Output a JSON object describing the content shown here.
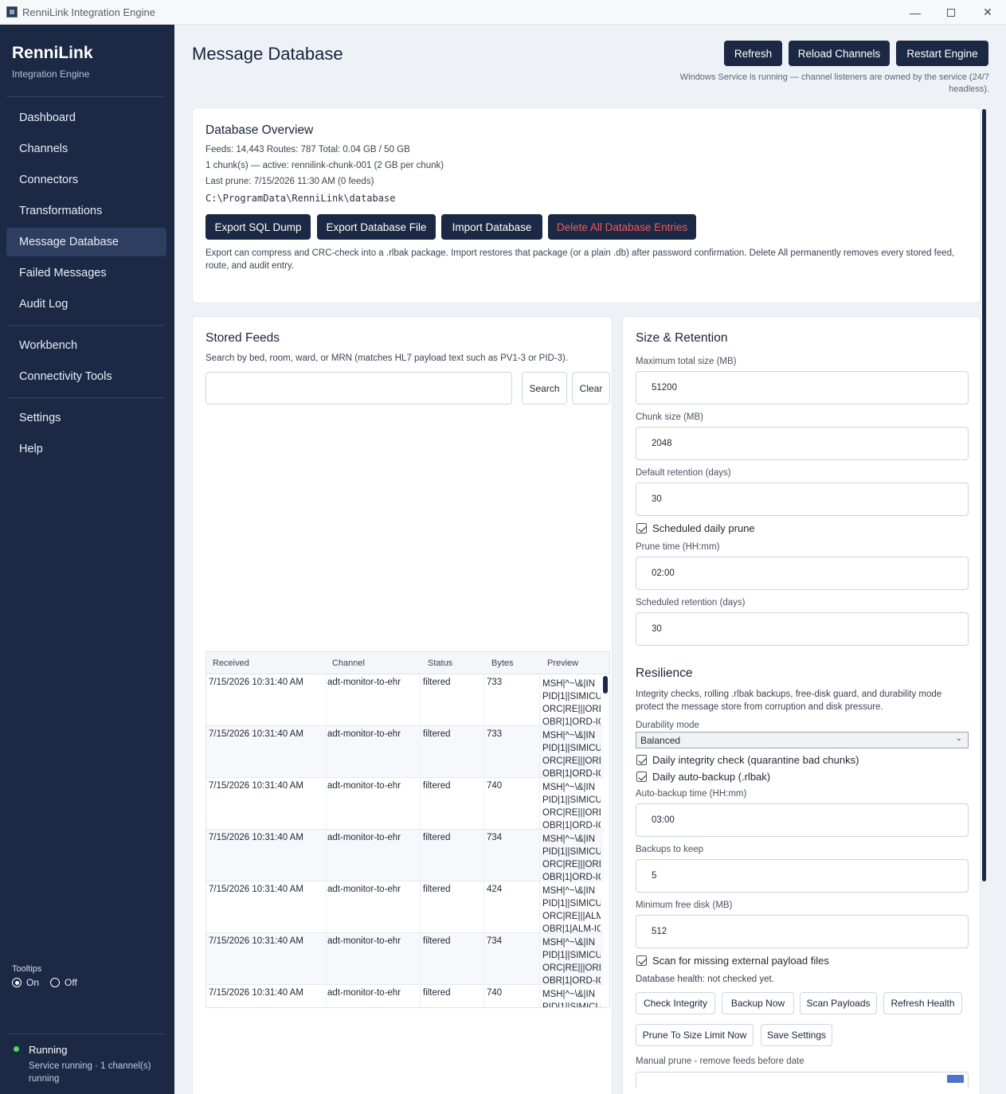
{
  "window": {
    "title": "RenniLink Integration Engine"
  },
  "sidebar": {
    "brand": "RenniLink",
    "subtitle": "Integration Engine",
    "items": [
      {
        "label": "Dashboard"
      },
      {
        "label": "Channels"
      },
      {
        "label": "Connectors"
      },
      {
        "label": "Transformations"
      },
      {
        "label": "Message Database",
        "active": true
      },
      {
        "label": "Failed Messages"
      },
      {
        "label": "Audit Log"
      },
      {
        "label": "Workbench"
      },
      {
        "label": "Connectivity Tools"
      },
      {
        "label": "Settings"
      },
      {
        "label": "Help"
      }
    ],
    "tooltips": {
      "label": "Tooltips",
      "on": "On",
      "off": "Off",
      "selected": "On"
    },
    "status": {
      "title": "Running",
      "detail": "Service running · 1 channel(s) running",
      "color": "#4cd964"
    }
  },
  "header": {
    "title": "Message Database",
    "buttons": {
      "refresh": "Refresh",
      "reload": "Reload Channels",
      "restart": "Restart Engine"
    },
    "service_note": "Windows Service is running — channel listeners are owned by the service (24/7 headless)."
  },
  "overview": {
    "title": "Database Overview",
    "stats": "Feeds: 14,443  Routes: 787  Total: 0.04 GB / 50 GB",
    "chunks": "1 chunk(s) — active: rennilink-chunk-001 (2 GB per chunk)",
    "last_prune": "Last prune: 7/15/2026 11:30 AM (0 feeds)",
    "path": "C:\\ProgramData\\RenniLink\\database",
    "buttons": {
      "export_sql": "Export SQL Dump",
      "export_file": "Export Database File",
      "import": "Import Database",
      "delete_all": "Delete All Database Entries"
    },
    "note": "Export can compress and CRC-check into a .rlbak package. Import restores that package (or a plain .db) after password confirmation. Delete All permanently removes every stored feed, route, and audit entry."
  },
  "feeds": {
    "title": "Stored Feeds",
    "hint": "Search by bed, room, ward, or MRN (matches HL7 payload text such as PV1-3 or PID-3).",
    "search_value": "",
    "search_label": "Search",
    "clear_label": "Clear",
    "columns": {
      "received": "Received",
      "channel": "Channel",
      "status": "Status",
      "bytes": "Bytes",
      "preview": "Preview"
    },
    "rows": [
      {
        "received": "7/15/2026 10:31:40 AM",
        "channel": "adt-monitor-to-ehr",
        "status": "filtered",
        "bytes": "733",
        "p1": "MSH|^~\\&|IN",
        "p2": "PID|1||SIMICU",
        "p3": "ORC|RE|||ORD",
        "p4": "OBR|1|ORD-IC"
      },
      {
        "received": "7/15/2026 10:31:40 AM",
        "channel": "adt-monitor-to-ehr",
        "status": "filtered",
        "bytes": "733",
        "p1": "MSH|^~\\&|IN",
        "p2": "PID|1||SIMICU",
        "p3": "ORC|RE|||ORD",
        "p4": "OBR|1|ORD-IC"
      },
      {
        "received": "7/15/2026 10:31:40 AM",
        "channel": "adt-monitor-to-ehr",
        "status": "filtered",
        "bytes": "740",
        "p1": "MSH|^~\\&|IN",
        "p2": "PID|1||SIMICU",
        "p3": "ORC|RE|||ORD",
        "p4": "OBR|1|ORD-IC"
      },
      {
        "received": "7/15/2026 10:31:40 AM",
        "channel": "adt-monitor-to-ehr",
        "status": "filtered",
        "bytes": "734",
        "p1": "MSH|^~\\&|IN",
        "p2": "PID|1||SIMICU",
        "p3": "ORC|RE|||ORD",
        "p4": "OBR|1|ORD-IC"
      },
      {
        "received": "7/15/2026 10:31:40 AM",
        "channel": "adt-monitor-to-ehr",
        "status": "filtered",
        "bytes": "424",
        "p1": "MSH|^~\\&|IN",
        "p2": "PID|1||SIMICU",
        "p3": "ORC|RE|||ALM",
        "p4": "OBR|1|ALM-IC"
      },
      {
        "received": "7/15/2026 10:31:40 AM",
        "channel": "adt-monitor-to-ehr",
        "status": "filtered",
        "bytes": "734",
        "p1": "MSH|^~\\&|IN",
        "p2": "PID|1||SIMICU",
        "p3": "ORC|RE|||ORD",
        "p4": "OBR|1|ORD-IC"
      },
      {
        "received": "7/15/2026 10:31:40 AM",
        "channel": "adt-monitor-to-ehr",
        "status": "filtered",
        "bytes": "740",
        "p1": "MSH|^~\\&|IN",
        "p2": "PID|1||SIMICU",
        "p3": "",
        "p4": ""
      }
    ]
  },
  "retention": {
    "title": "Size & Retention",
    "max_size_label": "Maximum total size (MB)",
    "max_size": "51200",
    "chunk_label": "Chunk size (MB)",
    "chunk": "2048",
    "default_ret_label": "Default retention (days)",
    "default_ret": "30",
    "daily_prune_label": "Scheduled daily prune",
    "prune_time_label": "Prune time (HH:mm)",
    "prune_time": "02:00",
    "sched_ret_label": "Scheduled retention (days)",
    "sched_ret": "30"
  },
  "resilience": {
    "title": "Resilience",
    "desc": "Integrity checks, rolling .rlbak backups, free-disk guard, and durability mode protect the message store from corruption and disk pressure.",
    "durability_label": "Durability mode",
    "durability": "Balanced",
    "integrity_label": "Daily integrity check (quarantine bad chunks)",
    "autobackup_label": "Daily auto-backup (.rlbak)",
    "backup_time_label": "Auto-backup time (HH:mm)",
    "backup_time": "03:00",
    "keep_label": "Backups to keep",
    "keep": "5",
    "min_disk_label": "Minimum free disk (MB)",
    "min_disk": "512",
    "scan_label": "Scan for missing external payload files",
    "health": "Database health: not checked yet.",
    "buttons": {
      "check": "Check Integrity",
      "backup": "Backup Now",
      "scan": "Scan Payloads",
      "refresh_health": "Refresh Health",
      "prune_size": "Prune To Size Limit Now",
      "save": "Save Settings"
    },
    "manual_prune_label": "Manual prune - remove feeds before date"
  }
}
